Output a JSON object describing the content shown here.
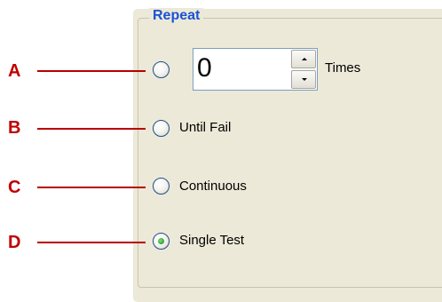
{
  "group": {
    "title": "Repeat"
  },
  "callouts": [
    "A",
    "B",
    "C",
    "D"
  ],
  "repeat_count": {
    "value": "0",
    "unit_label": "Times"
  },
  "options": [
    {
      "id": "times",
      "label": "",
      "selected": false
    },
    {
      "id": "until-fail",
      "label": "Until Fail",
      "selected": false
    },
    {
      "id": "continuous",
      "label": "Continuous",
      "selected": false
    },
    {
      "id": "single-test",
      "label": "Single Test",
      "selected": true
    }
  ],
  "colors": {
    "callout": "#c00000",
    "group_title": "#1a52d6",
    "panel_background": "#ece9d8",
    "radio_selected_dot": "#2ea02e"
  },
  "icons": {
    "spin_up": "triangle-up-icon",
    "spin_down": "triangle-down-icon"
  }
}
